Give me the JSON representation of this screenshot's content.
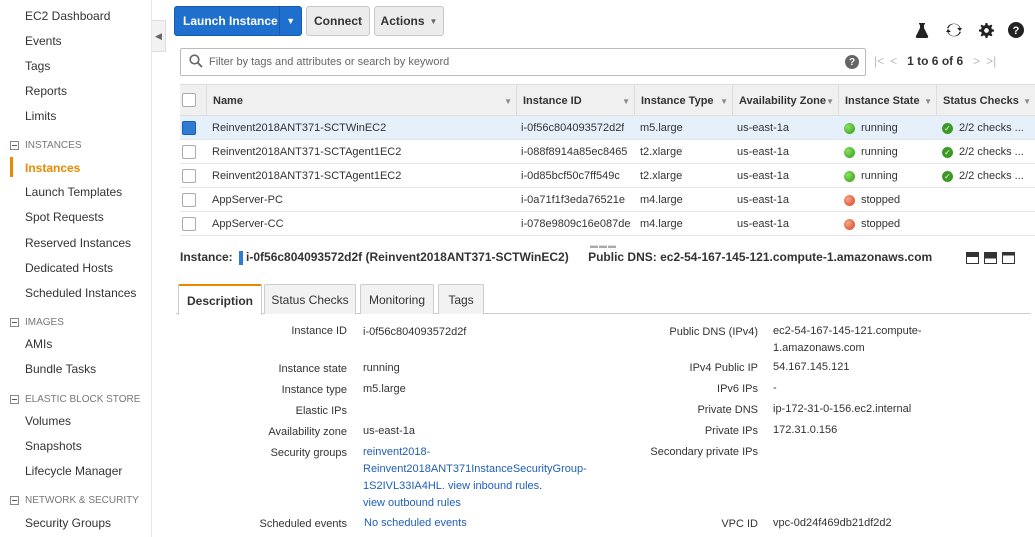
{
  "sidebar": {
    "items": [
      {
        "label": "EC2 Dashboard"
      },
      {
        "label": "Events"
      },
      {
        "label": "Tags"
      },
      {
        "label": "Reports"
      },
      {
        "label": "Limits"
      }
    ],
    "instances_section": "INSTANCES",
    "instances_items": [
      "Instances",
      "Launch Templates",
      "Spot Requests",
      "Reserved Instances",
      "Dedicated Hosts",
      "Scheduled Instances"
    ],
    "images_section": "IMAGES",
    "images_items": [
      "AMIs",
      "Bundle Tasks"
    ],
    "ebs_section": "ELASTIC BLOCK STORE",
    "ebs_items": [
      "Volumes",
      "Snapshots",
      "Lifecycle Manager"
    ],
    "network_section": "NETWORK & SECURITY",
    "network_items": [
      "Security Groups"
    ],
    "active_color": "#e88a00"
  },
  "toolbar": {
    "launch_label": "Launch Instance",
    "connect_label": "Connect",
    "actions_label": "Actions",
    "icons": [
      "flask-icon",
      "refresh-icon",
      "gear-icon",
      "help-icon"
    ]
  },
  "filter": {
    "placeholder": "Filter by tags and attributes or search by keyword",
    "pager_text": "1 to 6 of 6"
  },
  "table": {
    "headers": [
      "Name",
      "Instance ID",
      "Instance Type",
      "Availability Zone",
      "Instance State",
      "Status Checks"
    ],
    "rows": [
      {
        "name": "Reinvent2018ANT371-SCTWinEC2",
        "id": "i-0f56c804093572d2f",
        "type": "m5.large",
        "az": "us-east-1a",
        "state": "running",
        "checks": "2/2 checks ...",
        "selected": true
      },
      {
        "name": "Reinvent2018ANT371-SCTAgent1EC2",
        "id": "i-088f8914a85ec8465",
        "type": "t2.xlarge",
        "az": "us-east-1a",
        "state": "running",
        "checks": "2/2 checks ...",
        "selected": false
      },
      {
        "name": "Reinvent2018ANT371-SCTAgent1EC2",
        "id": "i-0d85bcf50c7ff549c",
        "type": "t2.xlarge",
        "az": "us-east-1a",
        "state": "running",
        "checks": "2/2 checks ...",
        "selected": false
      },
      {
        "name": "AppServer-PC",
        "id": "i-0a71f1f3eda76521e",
        "type": "m4.large",
        "az": "us-east-1a",
        "state": "stopped",
        "checks": "",
        "selected": false
      },
      {
        "name": "AppServer-CC",
        "id": "i-078e9809c16e087de",
        "type": "m4.large",
        "az": "us-east-1a",
        "state": "stopped",
        "checks": "",
        "selected": false
      }
    ]
  },
  "detail": {
    "instance_label": "Instance:",
    "instance_value": "i-0f56c804093572d2f (Reinvent2018ANT371-SCTWinEC2)",
    "dns_label": "Public DNS:",
    "dns_value": "ec2-54-167-145-121.compute-1.amazonaws.com",
    "tabs": [
      "Description",
      "Status Checks",
      "Monitoring",
      "Tags"
    ]
  },
  "description": {
    "left": [
      {
        "label": "Instance ID",
        "value": "i-0f56c804093572d2f"
      },
      {
        "label": "Instance state",
        "value": "running"
      },
      {
        "label": "Instance type",
        "value": "m5.large"
      },
      {
        "label": "Elastic IPs",
        "value": ""
      },
      {
        "label": "Availability zone",
        "value": "us-east-1a"
      },
      {
        "label": "Security groups",
        "value_line1": "reinvent2018-",
        "value_line2": "Reinvent2018ANT371InstanceSecurityGroup-",
        "value_line3a": "1S2IVL33IA4HL.",
        "value_line3b": "view inbound rules",
        "value_line3c": ".",
        "value_line4": "view outbound rules"
      },
      {
        "label": "Scheduled events",
        "value": "No scheduled events"
      }
    ],
    "right": [
      {
        "label": "Public DNS (IPv4)",
        "value_line1": "ec2-54-167-145-121.compute-",
        "value_line2": "1.amazonaws.com"
      },
      {
        "label": "IPv4 Public IP",
        "value": "54.167.145.121"
      },
      {
        "label": "IPv6 IPs",
        "value": "-"
      },
      {
        "label": "Private DNS",
        "value": "ip-172-31-0-156.ec2.internal"
      },
      {
        "label": "Private IPs",
        "value": "172.31.0.156"
      },
      {
        "label": "Secondary private IPs",
        "value": ""
      },
      {
        "label": "VPC ID",
        "value": "vpc-0d24f469db21df2d2"
      }
    ]
  }
}
